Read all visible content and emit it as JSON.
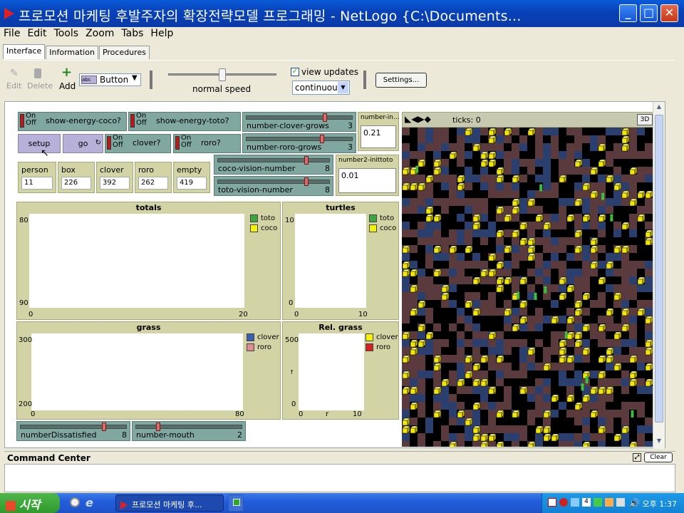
{
  "window": {
    "title": "프로모션 마케팅 후발주자의 확장전략모델 프로그래밍 - NetLogo {C:\\Documents..."
  },
  "menu": [
    "File",
    "Edit",
    "Tools",
    "Zoom",
    "Tabs",
    "Help"
  ],
  "tabs": [
    "Interface",
    "Information",
    "Procedures"
  ],
  "toolbar": {
    "edit": "Edit",
    "delete": "Delete",
    "add": "Add",
    "widget_type": "Button",
    "speed_label": "normal speed",
    "speed_level": 0.5,
    "view_updates_label": "view updates",
    "view_updates_checked": true,
    "update_mode": "continuous",
    "settings": "Settings..."
  },
  "switches": [
    {
      "on": "On",
      "off": "Off",
      "label": "show-energy-coco?"
    },
    {
      "on": "On",
      "off": "Off",
      "label": "show-energy-toto?"
    },
    {
      "on": "On",
      "off": "Off",
      "label": "clover?"
    },
    {
      "on": "On",
      "off": "Off",
      "label": "roro?"
    }
  ],
  "buttons": {
    "setup": "setup",
    "go": "go"
  },
  "sliders": [
    {
      "label": "number-clover-grows",
      "value": "3",
      "level": 0.75
    },
    {
      "label": "number-roro-grows",
      "value": "3",
      "level": 0.72
    },
    {
      "label": "coco-vision-number",
      "value": "8",
      "level": 0.8
    },
    {
      "label": "toto-vision-number",
      "value": "8",
      "level": 0.8
    },
    {
      "label": "numberDissatisfied",
      "value": "8",
      "level": 0.8
    },
    {
      "label": "number-mouth",
      "value": "2",
      "level": 0.2
    }
  ],
  "inputs": [
    {
      "label": "number-in...",
      "value": "0.21"
    },
    {
      "label": "number2-inittoto",
      "value": "0.01"
    }
  ],
  "monitors": [
    {
      "label": "person",
      "value": "11"
    },
    {
      "label": "box",
      "value": "226"
    },
    {
      "label": "clover",
      "value": "392"
    },
    {
      "label": "roro",
      "value": "262"
    },
    {
      "label": "empty",
      "value": "419"
    }
  ],
  "plots": {
    "totals": {
      "title": "totals",
      "ymax": "80",
      "ymin": "90",
      "xmin": "0",
      "xmax": "20",
      "legend": [
        "toto",
        "coco"
      ]
    },
    "turtles": {
      "title": "turtles",
      "ymax": "10",
      "ymin": "0",
      "xmin": "0",
      "xmax": "10",
      "legend": [
        "toto",
        "coco"
      ]
    },
    "grass": {
      "title": "grass",
      "ymax": "300",
      "ymin": "200",
      "xmin": "0",
      "xmax": "80",
      "legend": [
        "clover",
        "roro"
      ]
    },
    "rel_grass": {
      "title": "Rel. grass",
      "ymax": "500",
      "ymin": "0",
      "xmin": "0",
      "xmax": "10",
      "xlabel": "r",
      "ylabel": "f",
      "legend": [
        "clover",
        "roro"
      ]
    }
  },
  "colors": {
    "green": "#3fa53f",
    "yellow": "#f2f20a",
    "blue_legend": "#3a5fb0",
    "pink": "#e08a92",
    "red": "#d82020"
  },
  "view": {
    "ticks_label": "ticks: 0",
    "three_d": "3D"
  },
  "command_center": {
    "title": "Command Center",
    "clear": "Clear"
  },
  "taskbar": {
    "start": "시작",
    "task_label": "프로모션 마케팅 후...",
    "clock": "오후 1:37"
  }
}
